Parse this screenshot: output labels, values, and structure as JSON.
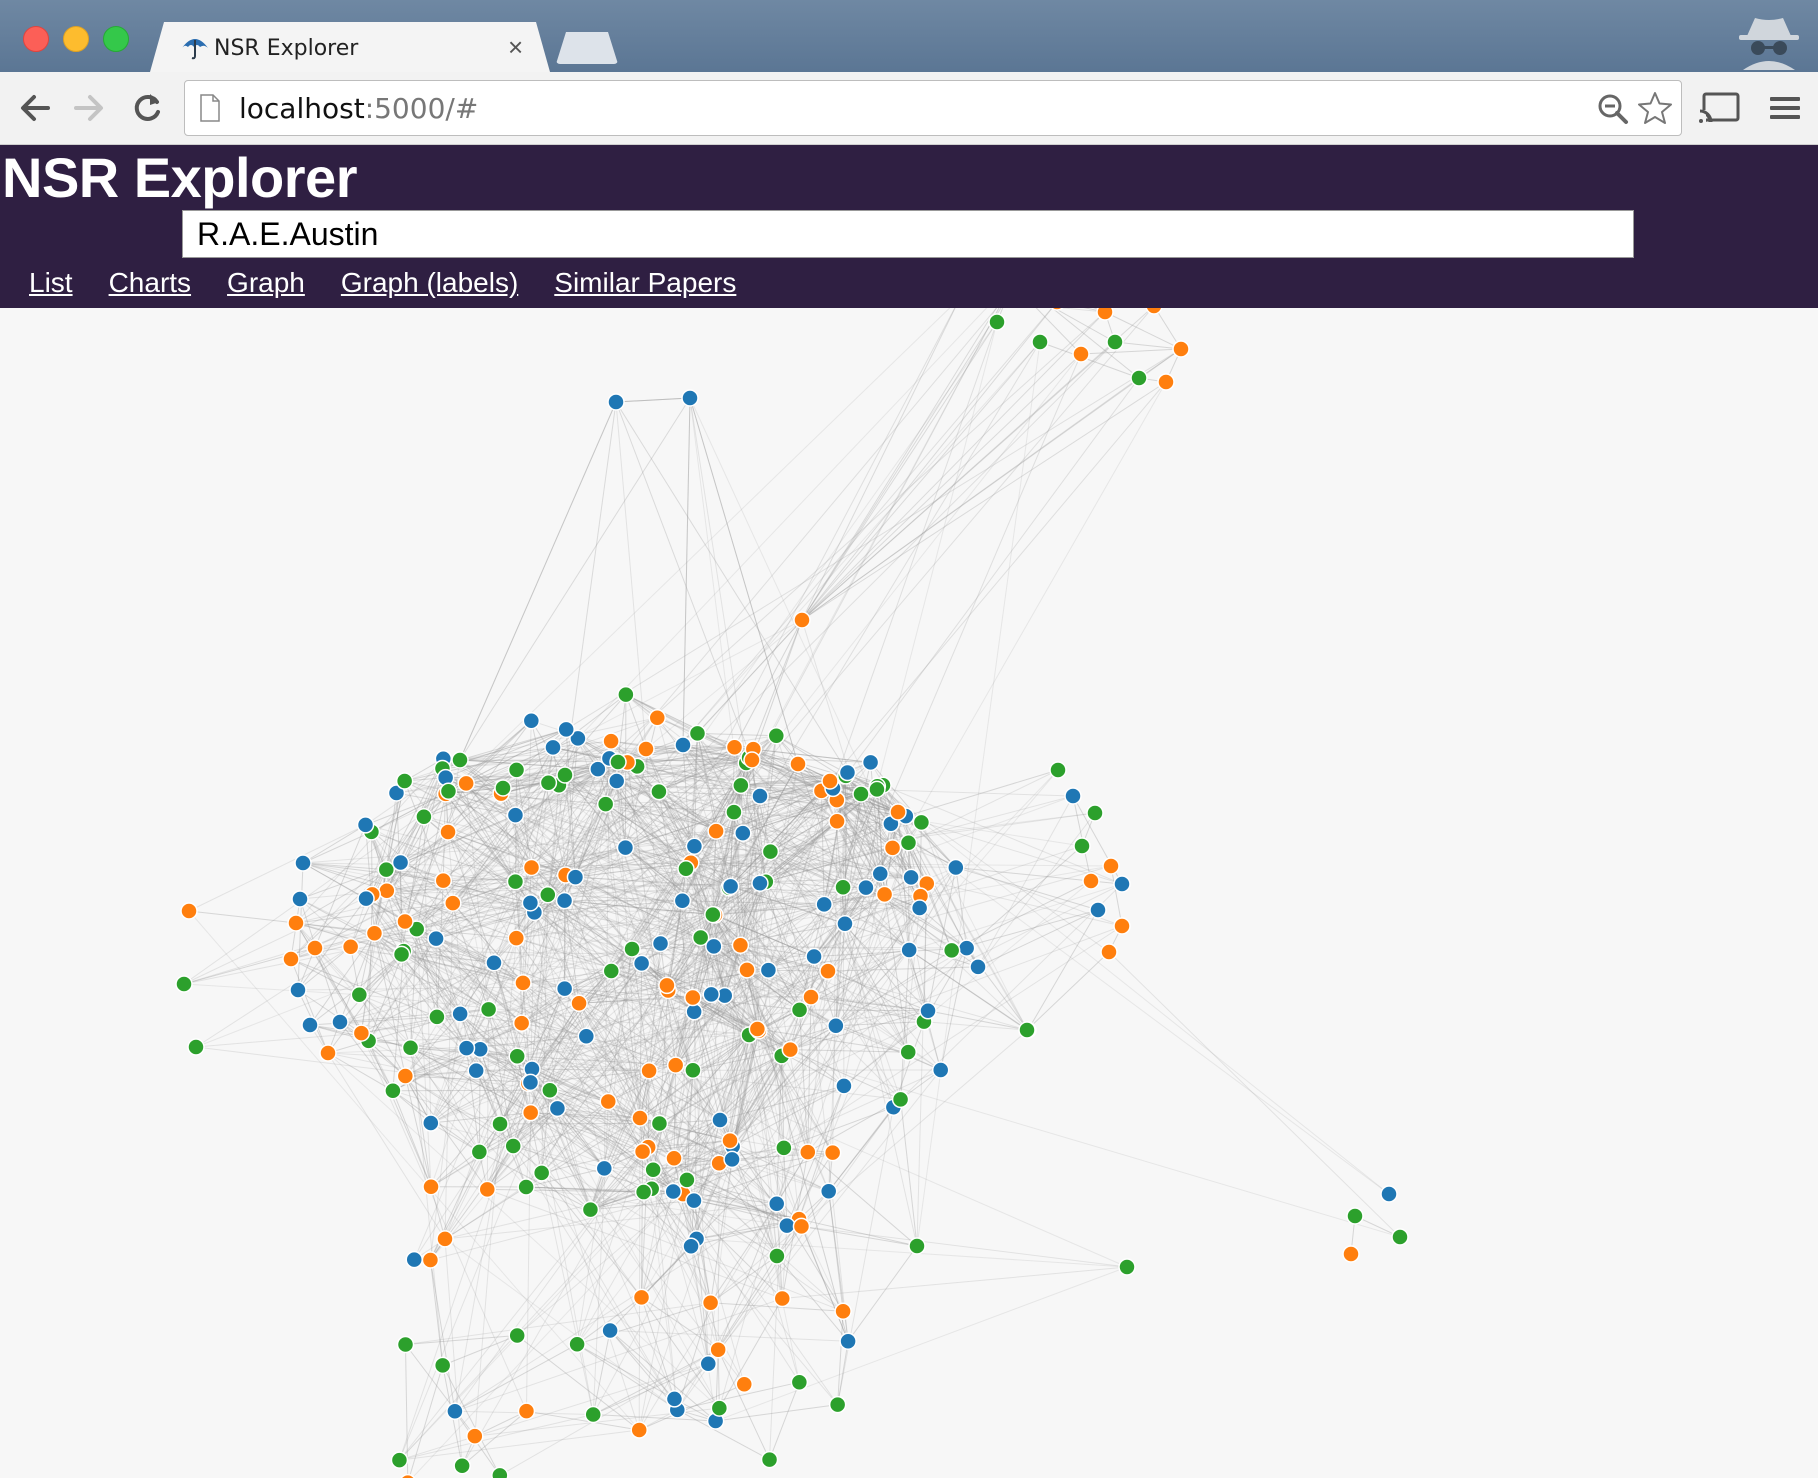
{
  "browser": {
    "tab_title": "NSR Explorer",
    "url_host": "localhost",
    "url_path": ":5000/#",
    "icons": [
      "close-window-icon",
      "minimize-window-icon",
      "zoom-window-icon",
      "favicon-umbrella-icon",
      "tab-close-icon",
      "new-tab-icon",
      "incognito-icon",
      "back-icon",
      "forward-icon",
      "reload-icon",
      "page-icon",
      "zoom-icon",
      "bookmark-star-icon",
      "cast-icon",
      "menu-icon"
    ]
  },
  "app": {
    "title": "NSR Explorer",
    "search_value": "R.A.E.Austin",
    "nav": [
      "List",
      "Charts",
      "Graph",
      "Graph (labels)",
      "Similar Papers"
    ]
  },
  "graph": {
    "colors": {
      "blue": "#1f77b4",
      "orange": "#ff7f0e",
      "green": "#2ca02c",
      "edge": "#999999",
      "background": "#f7f7f7"
    },
    "node_groups": [
      "blue",
      "orange",
      "green"
    ]
  }
}
